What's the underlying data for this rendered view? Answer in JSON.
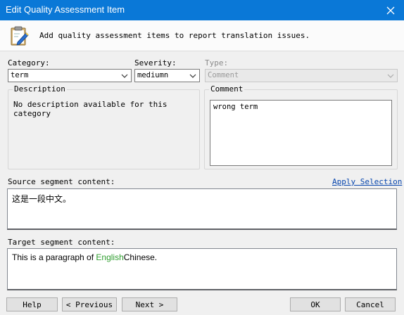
{
  "window": {
    "title": "Edit Quality Assessment Item"
  },
  "header": {
    "hint": "Add quality assessment items to report translation issues."
  },
  "fields": {
    "category": {
      "label": "Category:",
      "value": "term"
    },
    "severity": {
      "label": "Severity:",
      "value": "mediumn"
    },
    "type": {
      "label": "Type:",
      "value": "Comment",
      "disabled": true
    }
  },
  "description": {
    "title": "Description",
    "text": "No description available for this category"
  },
  "comment": {
    "title": "Comment",
    "text": "wrong term"
  },
  "source": {
    "label": "Source segment content:",
    "apply_selection": "Apply Selection",
    "text": "这是一段中文。"
  },
  "target": {
    "label": "Target segment content:",
    "text_prefix": "This is a paragraph of ",
    "text_highlight": "English",
    "text_suffix": "Chinese.",
    "highlight_color": "#2f9e2f"
  },
  "buttons": {
    "help": "Help",
    "previous": "< Previous",
    "next": "Next >",
    "ok": "OK",
    "cancel": "Cancel"
  },
  "colors": {
    "titlebar": "#0a78d7",
    "link": "#0645ad"
  }
}
